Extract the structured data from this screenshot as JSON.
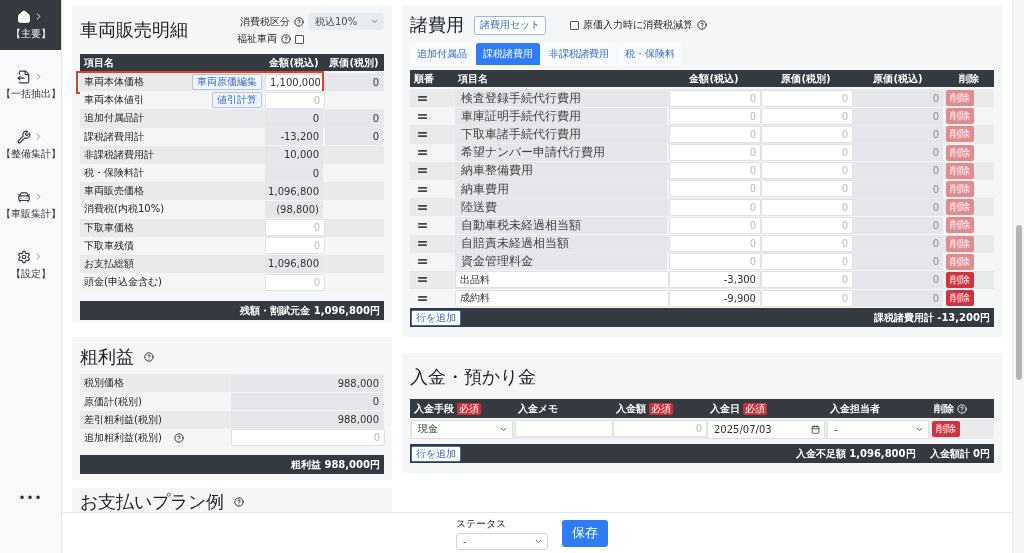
{
  "sidebar": {
    "items": [
      {
        "kind": "home",
        "label": "【主要】",
        "selected": true
      },
      {
        "kind": "export",
        "label": "【一括抽出】",
        "selected": false
      },
      {
        "kind": "maintenance",
        "label": "【整備集計】",
        "selected": false
      },
      {
        "kind": "car",
        "label": "【車販集計】",
        "selected": false
      },
      {
        "kind": "settings",
        "label": "【設定】",
        "selected": false
      }
    ],
    "more": "•••"
  },
  "sales": {
    "title": "車両販売明細",
    "tax_type": {
      "label": "消費税区分",
      "value": "税込10%"
    },
    "welfare": {
      "label": "福祉車両",
      "checked": false
    },
    "columns": [
      "項目名",
      "金額(税込)",
      "原価(税別)"
    ],
    "rows": [
      {
        "name": "車両本体価格",
        "action": "車両原価編集",
        "amount": {
          "kind": "input",
          "value": "1,100,000"
        },
        "cost": "0",
        "highlighted": true
      },
      {
        "name": "車両本体値引",
        "action": "値引計算",
        "amount": {
          "kind": "input",
          "placeholder": "0"
        },
        "highlighted": false
      },
      {
        "name": "追加付属品計",
        "amount": {
          "kind": "readonly",
          "text": "0"
        },
        "cost": "0",
        "highlighted": false
      },
      {
        "name": "課税諸費用計",
        "amount": {
          "kind": "readonly",
          "text": "-13,200"
        },
        "cost": "0",
        "highlighted": false
      },
      {
        "name": "非課税諸費用計",
        "amount": {
          "kind": "readonly",
          "text": "10,000"
        },
        "highlighted": false
      },
      {
        "name": "税・保険料計",
        "amount": {
          "kind": "readonly",
          "text": "0"
        },
        "highlighted": false
      },
      {
        "name": "車両販売価格",
        "amount": {
          "kind": "readonly",
          "text": "1,096,800"
        },
        "highlighted": false
      },
      {
        "name": "消費税(内税10%)",
        "amount": {
          "kind": "readonly",
          "text": "(98,800)"
        },
        "highlighted": false
      },
      {
        "name": "下取車価格",
        "amount": {
          "kind": "input",
          "placeholder": "0"
        },
        "highlighted": false
      },
      {
        "name": "下取車残債",
        "amount": {
          "kind": "input",
          "placeholder": "0"
        },
        "highlighted": false
      },
      {
        "name": "お支払総額",
        "amount": {
          "kind": "readonly",
          "text": "1,096,800"
        },
        "highlighted": false
      },
      {
        "name": "頭金(申込金含む)",
        "amount": {
          "kind": "input",
          "placeholder": "0"
        },
        "highlighted": false
      }
    ],
    "footer": "残額・割賦元金 1,096,800円"
  },
  "gross": {
    "title": "粗利益",
    "rows": [
      {
        "name": "税別価格",
        "value": {
          "kind": "readonly",
          "text": "988,000"
        },
        "help": false
      },
      {
        "name": "原価計(税別)",
        "value": {
          "kind": "readonly",
          "text": "0"
        },
        "help": false
      },
      {
        "name": "差引粗利益(税別)",
        "value": {
          "kind": "readonly",
          "text": "988,000"
        },
        "help": false
      },
      {
        "name": "追加粗利益(税別)",
        "value": {
          "kind": "input",
          "placeholder": "0"
        },
        "help": true
      }
    ],
    "footer": "粗利益 988,000円"
  },
  "plan": {
    "title": "お支払いプラン例"
  },
  "fees": {
    "title": "諸費用",
    "set_button": "諸費用セット",
    "cost_tax_option": {
      "label": "原価入力時に消費税減算",
      "checked": false
    },
    "tabs": [
      {
        "label": "追加付属品",
        "selected": false
      },
      {
        "label": "課税諸費用",
        "selected": true
      },
      {
        "label": "非課税諸費用",
        "selected": false
      },
      {
        "label": "税・保険料",
        "selected": false
      }
    ],
    "columns": [
      "順番",
      "項目名",
      "金額(税込)",
      "原価(税別)",
      "原価(税込)",
      "削除"
    ],
    "rows": [
      {
        "name": "検査登録手続代行費用",
        "name_editable": false,
        "amount": {
          "placeholder": "0"
        },
        "cost": {
          "placeholder": "0"
        },
        "cost_incl": "0",
        "delete": "削除",
        "disabled": true
      },
      {
        "name": "車庫証明手続代行費用",
        "name_editable": false,
        "amount": {
          "placeholder": "0"
        },
        "cost": {
          "placeholder": "0"
        },
        "cost_incl": "0",
        "delete": "削除",
        "disabled": true
      },
      {
        "name": "下取車諸手続代行費用",
        "name_editable": false,
        "amount": {
          "placeholder": "0"
        },
        "cost": {
          "placeholder": "0"
        },
        "cost_incl": "0",
        "delete": "削除",
        "disabled": true
      },
      {
        "name": "希望ナンバー申請代行費用",
        "name_editable": false,
        "amount": {
          "placeholder": "0"
        },
        "cost": {
          "placeholder": "0"
        },
        "cost_incl": "0",
        "delete": "削除",
        "disabled": true
      },
      {
        "name": "納車整備費用",
        "name_editable": false,
        "amount": {
          "placeholder": "0"
        },
        "cost": {
          "placeholder": "0"
        },
        "cost_incl": "0",
        "delete": "削除",
        "disabled": true
      },
      {
        "name": "納車費用",
        "name_editable": false,
        "amount": {
          "placeholder": "0"
        },
        "cost": {
          "placeholder": "0"
        },
        "cost_incl": "0",
        "delete": "削除",
        "disabled": true
      },
      {
        "name": "陸送費",
        "name_editable": false,
        "amount": {
          "placeholder": "0"
        },
        "cost": {
          "placeholder": "0"
        },
        "cost_incl": "0",
        "delete": "削除",
        "disabled": true
      },
      {
        "name": "自動車税未経過相当額",
        "name_editable": false,
        "amount": {
          "placeholder": "0"
        },
        "cost": {
          "placeholder": "0"
        },
        "cost_incl": "0",
        "delete": "削除",
        "disabled": true
      },
      {
        "name": "自賠責未経過相当額",
        "name_editable": false,
        "amount": {
          "placeholder": "0"
        },
        "cost": {
          "placeholder": "0"
        },
        "cost_incl": "0",
        "delete": "削除",
        "disabled": true
      },
      {
        "name": "資金管理料金",
        "name_editable": false,
        "amount": {
          "placeholder": "0"
        },
        "cost": {
          "placeholder": "0"
        },
        "cost_incl": "0",
        "delete": "削除",
        "disabled": true
      },
      {
        "name": "出品料",
        "name_editable": true,
        "amount": {
          "value": "-3,300"
        },
        "cost": {
          "placeholder": "0"
        },
        "cost_incl": "0",
        "delete": "削除",
        "disabled": false
      },
      {
        "name": "成約料",
        "name_editable": true,
        "amount": {
          "value": "-9,900"
        },
        "cost": {
          "placeholder": "0"
        },
        "cost_incl": "0",
        "delete": "削除",
        "disabled": false
      }
    ],
    "add_row": "行を追加",
    "total": "課税諸費用計 -13,200円"
  },
  "payments": {
    "title": "入金・預かり金",
    "columns": [
      {
        "label": "入金手段",
        "badge": "必須",
        "help": false
      },
      {
        "label": "入金メモ",
        "help": false
      },
      {
        "label": "入金額",
        "badge": "必須",
        "help": false
      },
      {
        "label": "入金日",
        "badge": "必須",
        "help": false
      },
      {
        "label": "入金担当者",
        "help": false
      },
      {
        "label": "削除",
        "help": true
      }
    ],
    "rows": [
      {
        "method": "現金",
        "amount": {
          "placeholder": "0"
        },
        "date": "2025/07/03",
        "staff": "-",
        "delete": "削除"
      }
    ],
    "add_row": "行を追加",
    "shortage": "入金不足額 1,096,800円",
    "total": "入金額計 0円"
  },
  "bottom": {
    "status": {
      "label": "ステータス",
      "value": "-"
    },
    "save": "保存"
  }
}
